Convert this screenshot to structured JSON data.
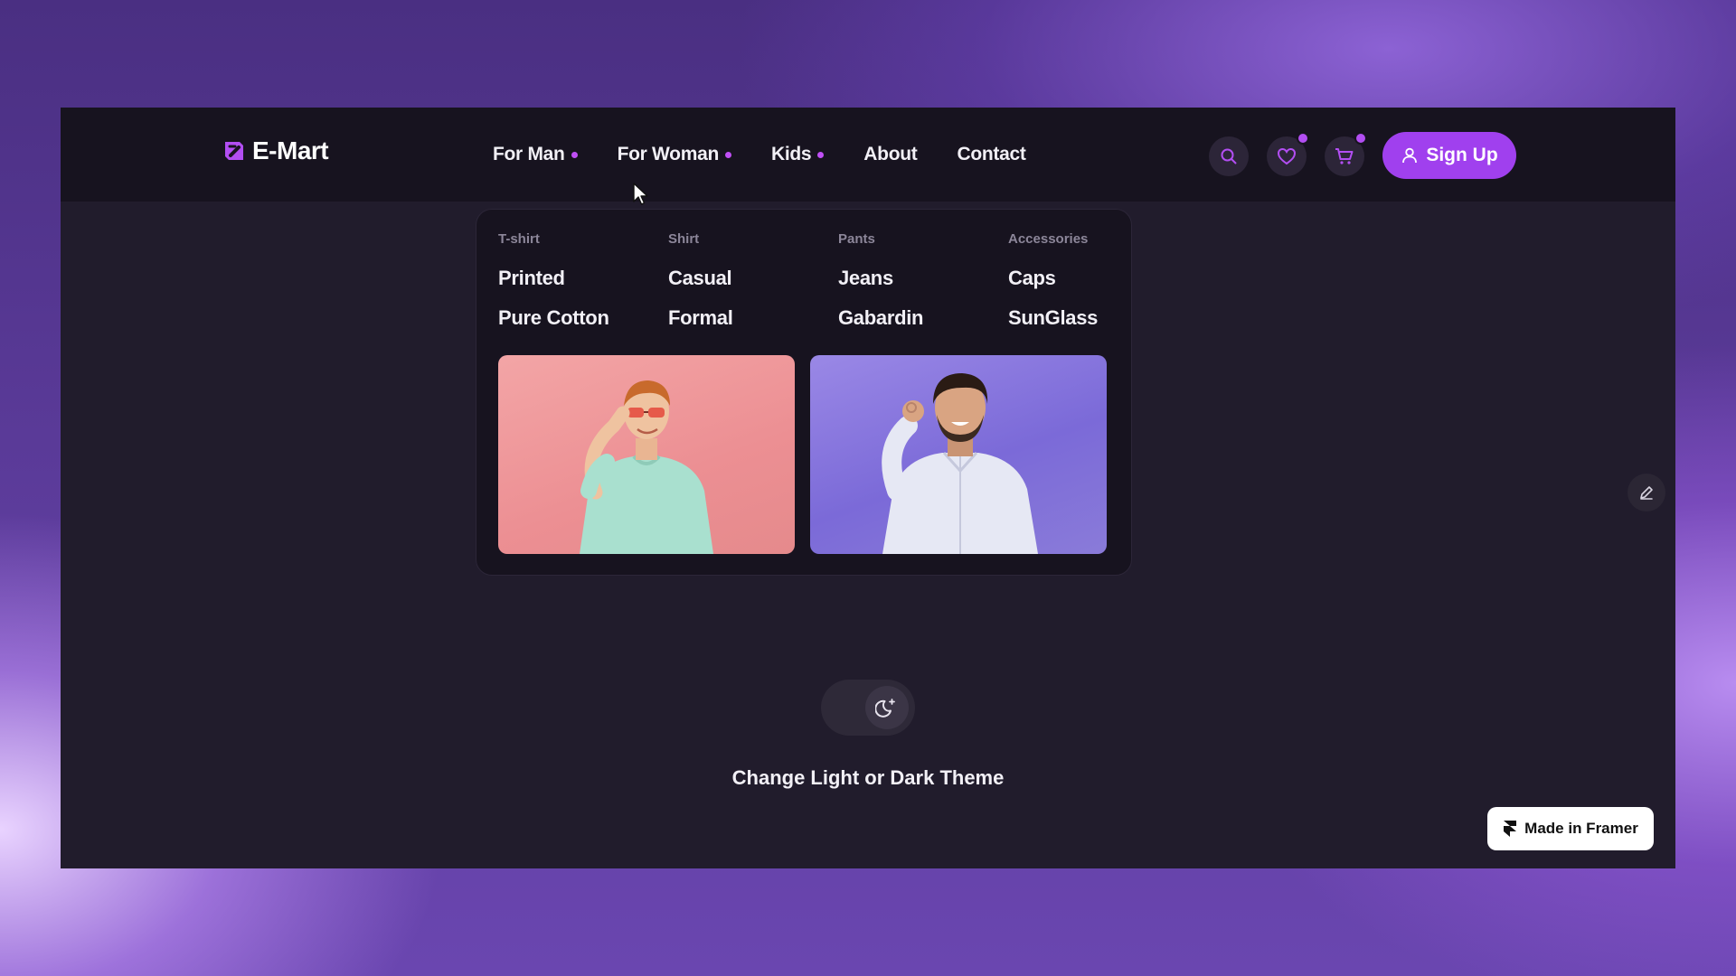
{
  "brand": {
    "name": "E-Mart"
  },
  "nav": {
    "items": [
      {
        "label": "For Man",
        "has_dropdown": true
      },
      {
        "label": "For Woman",
        "has_dropdown": true
      },
      {
        "label": "Kids",
        "has_dropdown": true
      },
      {
        "label": "About",
        "has_dropdown": false
      },
      {
        "label": "Contact",
        "has_dropdown": false
      }
    ]
  },
  "header_actions": {
    "search_icon": "search-icon",
    "wishlist_icon": "heart-icon",
    "cart_icon": "cart-icon",
    "signup_label": "Sign Up",
    "signup_icon": "user-icon"
  },
  "mega_menu": {
    "columns": [
      {
        "heading": "T-shirt",
        "items": [
          "Printed",
          "Pure Cotton"
        ]
      },
      {
        "heading": "Shirt",
        "items": [
          "Casual",
          "Formal"
        ]
      },
      {
        "heading": "Pants",
        "items": [
          "Jeans",
          "Gabardin"
        ]
      },
      {
        "heading": "Accessories",
        "items": [
          "Caps",
          "SunGlass"
        ]
      }
    ],
    "promo_images": [
      {
        "icon": "man-in-tshirt-photo"
      },
      {
        "icon": "man-in-shirt-photo"
      }
    ]
  },
  "theme": {
    "label": "Change Light or Dark Theme",
    "icon": "moon-icon"
  },
  "footer_badge": {
    "label": "Made in Framer",
    "icon": "framer-icon"
  },
  "colors": {
    "accent": "#a040ee",
    "dot": "#c04ff5",
    "background": "#211c2c",
    "navbar": "#17131f"
  }
}
